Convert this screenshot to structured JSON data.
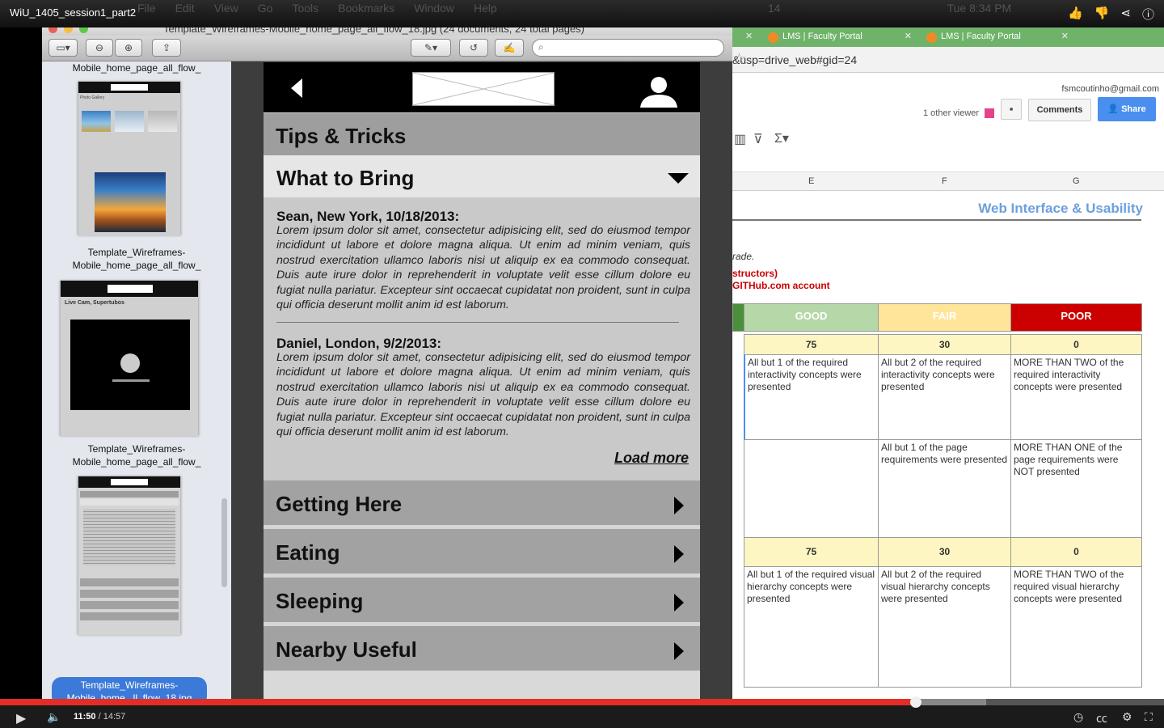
{
  "video": {
    "title": "WiU_1405_session1_part2",
    "current_time": "11:50",
    "duration": "14:57",
    "progress_fraction": 0.792
  },
  "mac_menu": {
    "items": [
      "File",
      "Edit",
      "View",
      "Go",
      "Tools",
      "Bookmarks",
      "Window",
      "Help"
    ],
    "status": [
      "14",
      "Tue 8:34 PM"
    ]
  },
  "preview": {
    "title": "Template_Wireframes-Mobile_home_page_all_flow_18.jpg (24 documents, 24 total pages)",
    "sidebar": {
      "top_label": "Mobile_home_page_all_flow_",
      "thumb_labels": [
        "Template_Wireframes-\nMobile_home_page_all_flow_",
        "Template_Wireframes-\nMobile_home_page_all_flow_"
      ],
      "thumb_photo_gallery": "Photo Gallery",
      "thumb_live_cam": "Live Cam, Supertubos",
      "selected_label": "Template_Wireframes-\nMobile_home...ll_flow_18.jpg"
    }
  },
  "phone": {
    "section_title": "Tips & Tricks",
    "open_accordion": "What to Bring",
    "reviews": [
      {
        "author": "Sean, New York, 10/18/2013:",
        "text": "Lorem ipsum dolor sit amet, consectetur adipisicing elit, sed do eiusmod tempor incididunt ut labore et dolore magna aliqua. Ut enim ad minim veniam, quis nostrud exercitation ullamco laboris nisi ut aliquip ex ea commodo consequat. Duis aute irure dolor in reprehenderit in voluptate velit esse cillum dolore eu fugiat nulla pariatur. Excepteur sint occaecat cupidatat non proident, sunt in culpa qui officia deserunt mollit anim id est laborum."
      },
      {
        "author": "Daniel, London, 9/2/2013:",
        "text": "Lorem ipsum dolor sit amet, consectetur adipisicing elit, sed do eiusmod tempor incididunt ut labore et dolore magna aliqua. Ut enim ad minim veniam, quis nostrud exercitation ullamco laboris nisi ut aliquip ex ea commodo consequat. Duis aute irure dolor in reprehenderit in voluptate velit esse cillum dolore eu fugiat nulla pariatur. Excepteur sint occaecat cupidatat non proident, sunt in culpa qui officia deserunt mollit anim id est laborum."
      }
    ],
    "load_more": "Load more",
    "collapsed_sections": [
      "Getting Here",
      "Eating",
      "Sleeping",
      "Nearby Useful"
    ]
  },
  "sheet": {
    "tabs": [
      "LMS | Faculty Portal",
      "LMS | Faculty Portal"
    ],
    "url": "&usp=drive_web#gid=24",
    "email": "fsmcoutinho@gmail.com",
    "viewers": "1 other viewer",
    "comments_label": "Comments",
    "share_label": "Share",
    "columns": [
      "E",
      "F",
      "G"
    ],
    "banner": "Web Interface & Usability",
    "notes": [
      "rade.",
      "structors)",
      "GITHub.com account"
    ],
    "rating_headers": [
      "GOOD",
      "FAIR",
      "POOR"
    ],
    "colors": {
      "good": "#b6d7a8",
      "fair": "#ffe599",
      "poor": "#cc0000",
      "accent_tab": "#6fb36a"
    },
    "rows": [
      {
        "scores": [
          "75",
          "30",
          "0"
        ],
        "cells": [
          "All but 1 of the required interactivity concepts were presented",
          "All but 2 of the required interactivity concepts were presented",
          "MORE THAN TWO of the required interactivity concepts were presented"
        ]
      },
      {
        "cells": [
          "",
          "All but 1 of the page requirements were presented",
          "MORE THAN ONE of the page requirements were NOT presented"
        ]
      },
      {
        "scores": [
          "75",
          "30",
          "0"
        ],
        "cells": [
          "All but 1 of the required visual hierarchy concepts were presented",
          "All but 2 of the required visual hierarchy concepts were presented",
          "MORE THAN TWO of the required visual hierarchy concepts were presented"
        ]
      }
    ]
  }
}
